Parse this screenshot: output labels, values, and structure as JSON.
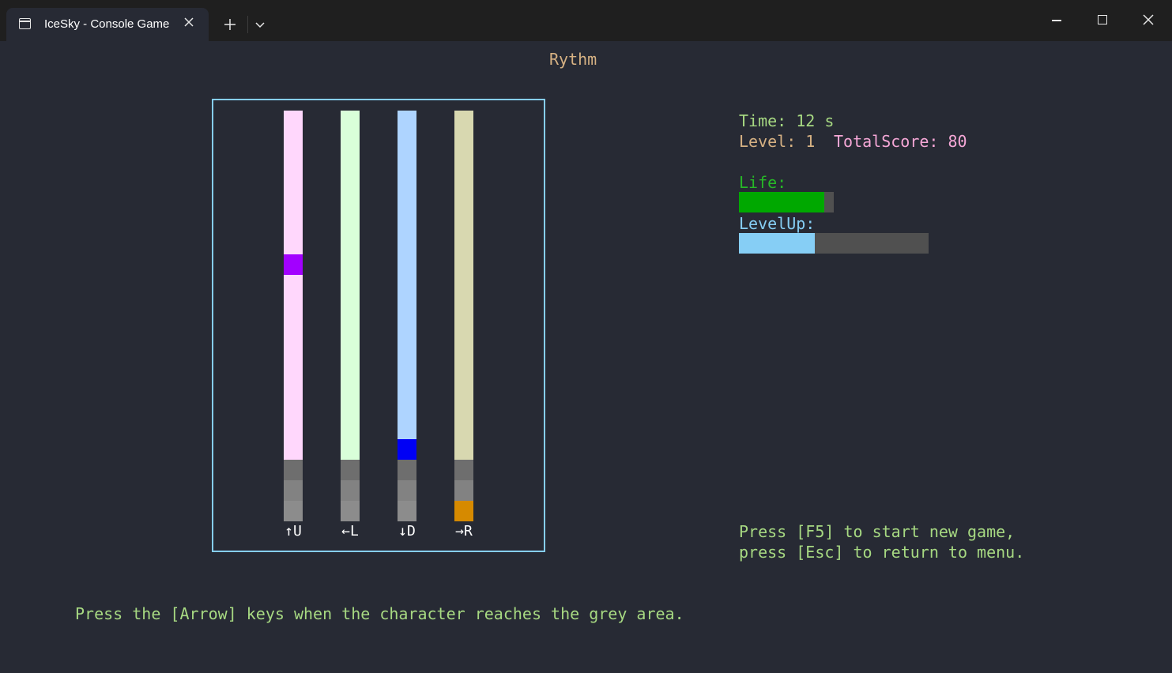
{
  "window": {
    "tab_title": "IceSky - Console Game",
    "tab_icon": "terminal-icon",
    "close_tab_icon": "close-icon",
    "new_tab_icon": "plus-icon",
    "dropdown_icon": "chevron-down-icon",
    "controls": [
      "minimize-icon",
      "maximize-icon",
      "close-icon"
    ]
  },
  "game": {
    "title": "Rythm",
    "time_text": "Time: 12 s",
    "level_text": "Level: 1",
    "total_score_text": "TotalScore: 80",
    "life_label": "Life:",
    "life_fraction": 0.9,
    "levelup_label": "LevelUp:",
    "levelup_fraction": 0.4,
    "help_line1": "Press [F5] to start new game,",
    "help_line2": "press [Esc] to return to menu.",
    "instruction": "Press the [Arrow] keys when the character reaches the grey area."
  },
  "lanes": [
    {
      "key_label": "↑U",
      "track_color": "#ffd7fc",
      "note_color": "#a200ff",
      "note_row": 7,
      "hit_colors": [
        "#6e6e6e",
        "#828282",
        "#8c8c8c"
      ]
    },
    {
      "key_label": "←L",
      "track_color": "#d9ffd9",
      "note_color": null,
      "note_row": null,
      "hit_colors": [
        "#6e6e6e",
        "#828282",
        "#8c8c8c"
      ]
    },
    {
      "key_label": "↓D",
      "track_color": "#aed4ff",
      "note_color": "#0000f5",
      "note_row": 16,
      "hit_colors": [
        "#6e6e6e",
        "#828282",
        "#8c8c8c"
      ]
    },
    {
      "key_label": "→R",
      "track_color": "#d8d8b0",
      "note_color": null,
      "note_row": null,
      "hit_colors": [
        "#6e6e6e",
        "#828282",
        "#d68a00"
      ]
    }
  ],
  "colors": {
    "background": "#272a34",
    "board_border": "#86cef5",
    "life_fill": "#00a800",
    "levelup_fill": "#86cef5",
    "bar_track": "#505050"
  }
}
